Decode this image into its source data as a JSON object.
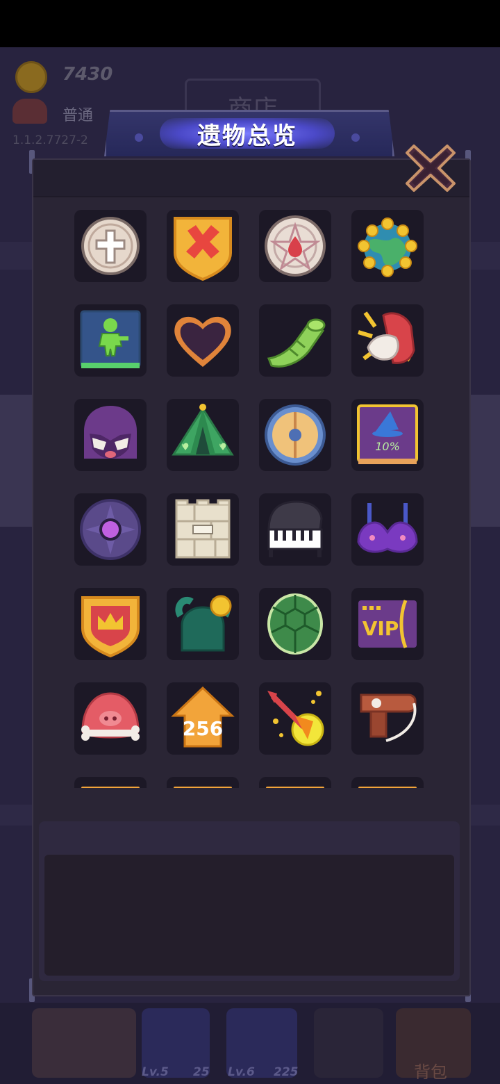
{
  "background": {
    "coins": "7430",
    "mode": "普通",
    "version": "1.1.2.7727-2",
    "shop_title": "商店",
    "bottom_bar": [
      {
        "level": "Lv.5",
        "value": "25"
      },
      {
        "level": "Lv.6",
        "value": "225"
      }
    ],
    "bag_label": "背包"
  },
  "modal": {
    "title": "遗物总览",
    "description": ""
  },
  "relics": [
    {
      "icon": "holy-cross-coin-icon"
    },
    {
      "icon": "red-x-shield-icon"
    },
    {
      "icon": "pentagram-coin-icon"
    },
    {
      "icon": "coin-planet-icon"
    },
    {
      "icon": "toy-soldier-book-icon"
    },
    {
      "icon": "dark-heart-icon"
    },
    {
      "icon": "green-horn-icon"
    },
    {
      "icon": "spiked-red-glove-icon"
    },
    {
      "icon": "purple-angry-mask-icon"
    },
    {
      "icon": "green-tent-icon"
    },
    {
      "icon": "round-wooden-shield-icon"
    },
    {
      "icon": "wizard-hat-book-icon",
      "label": "10%"
    },
    {
      "icon": "purple-eye-compass-icon"
    },
    {
      "icon": "stone-brick-wall-icon"
    },
    {
      "icon": "grand-piano-icon"
    },
    {
      "icon": "purple-bra-icon"
    },
    {
      "icon": "crown-shield-icon"
    },
    {
      "icon": "cactus-armor-coin-icon"
    },
    {
      "icon": "turtle-shell-icon"
    },
    {
      "icon": "vip-card-icon",
      "label": "VIP"
    },
    {
      "icon": "pig-bone-icon"
    },
    {
      "icon": "orange-arrow-256-icon",
      "label": "256"
    },
    {
      "icon": "fire-arrow-coin-icon"
    },
    {
      "icon": "brown-hair-dryer-icon"
    },
    {
      "icon": "partial-relic-icon"
    },
    {
      "icon": "partial-relic-icon"
    },
    {
      "icon": "partial-relic-icon"
    },
    {
      "icon": "partial-relic-icon"
    }
  ],
  "colors": {
    "panel": "#2a2535",
    "tile": "#1c1826",
    "title_glow": "#6d6cf0",
    "close_button": "#4a2a3e"
  }
}
